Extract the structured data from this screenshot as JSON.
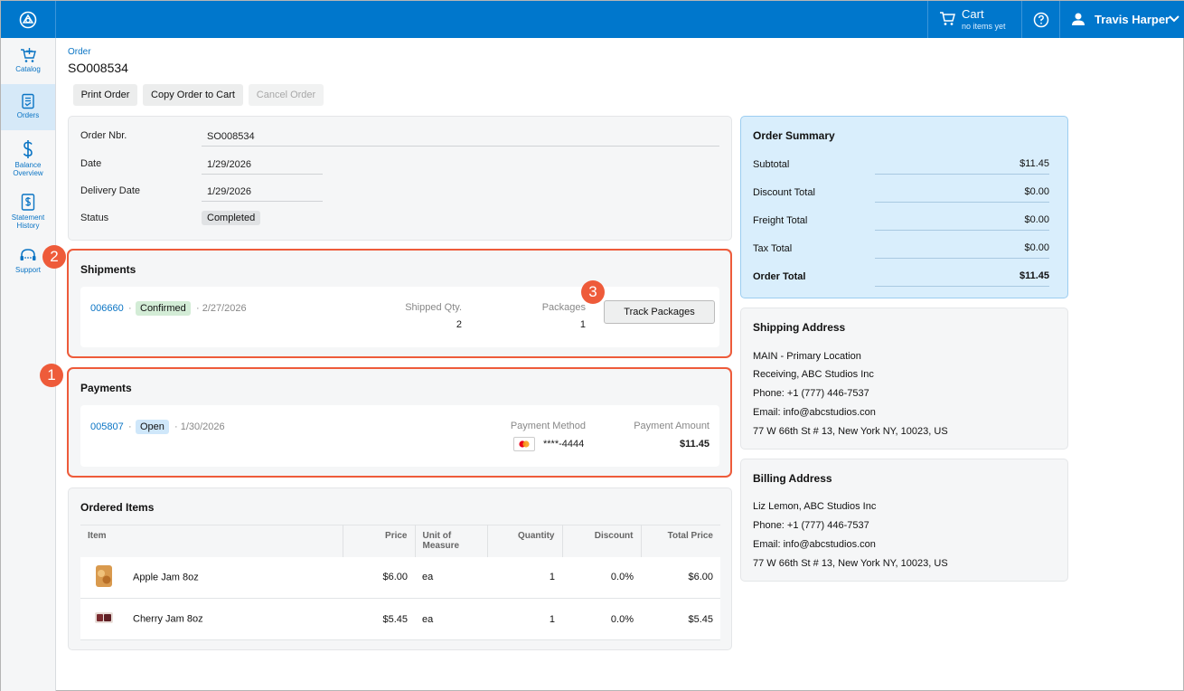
{
  "topbar": {
    "cart_label": "Cart",
    "cart_sub": "no items yet",
    "user_name": "Travis Harper"
  },
  "sidebar": {
    "items": [
      {
        "label": "Catalog",
        "icon": "cart-plus-icon"
      },
      {
        "label": "Orders",
        "icon": "orders-icon"
      },
      {
        "label": "Balance Overview",
        "icon": "dollar-icon"
      },
      {
        "label": "Statement History",
        "icon": "statement-icon"
      },
      {
        "label": "Support",
        "icon": "headset-icon"
      }
    ]
  },
  "breadcrumb": "Order",
  "page_title": "SO008534",
  "actions": {
    "print": "Print Order",
    "copy": "Copy Order to Cart",
    "cancel": "Cancel Order"
  },
  "order": {
    "nbr_label": "Order Nbr.",
    "nbr": "SO008534",
    "date_label": "Date",
    "date": "1/29/2026",
    "delivery_label": "Delivery Date",
    "delivery": "1/29/2026",
    "status_label": "Status",
    "status": "Completed"
  },
  "badges": {
    "one": "1",
    "two": "2",
    "three": "3"
  },
  "shipments": {
    "title": "Shipments",
    "number": "006660",
    "sep": "·",
    "status": "Confirmed",
    "date": "· 2/27/2026",
    "qty_label": "Shipped Qty.",
    "qty": "2",
    "packages_label": "Packages",
    "packages": "1",
    "track": "Track Packages"
  },
  "payments": {
    "title": "Payments",
    "number": "005807",
    "sep": "·",
    "status": "Open",
    "date": "· 1/30/2026",
    "method_label": "Payment Method",
    "method": "****-4444",
    "amount_label": "Payment Amount",
    "amount": "$11.45"
  },
  "items": {
    "title": "Ordered Items",
    "headers": {
      "item": "Item",
      "price": "Price",
      "uom_1": "Unit of",
      "uom_2": "Measure",
      "qty": "Quantity",
      "discount": "Discount",
      "total": "Total Price"
    },
    "rows": [
      {
        "name": "Apple Jam 8oz",
        "price": "$6.00",
        "uom": "ea",
        "qty": "1",
        "discount": "0.0%",
        "total": "$6.00"
      },
      {
        "name": "Cherry Jam 8oz",
        "price": "$5.45",
        "uom": "ea",
        "qty": "1",
        "discount": "0.0%",
        "total": "$5.45"
      }
    ]
  },
  "summary": {
    "title": "Order Summary",
    "subtotal_label": "Subtotal",
    "subtotal": "$11.45",
    "discount_label": "Discount Total",
    "discount": "$0.00",
    "freight_label": "Freight Total",
    "freight": "$0.00",
    "tax_label": "Tax Total",
    "tax": "$0.00",
    "total_label": "Order Total",
    "total": "$11.45"
  },
  "shipping": {
    "title": "Shipping Address",
    "line1": "MAIN - Primary Location",
    "line2": "Receiving, ABC Studios Inc",
    "phone": "Phone:  +1 (777) 446-7537",
    "email": "Email:  info@abcstudios.con",
    "address": "77 W 66th St # 13, New York NY, 10023, US"
  },
  "billing": {
    "title": "Billing Address",
    "line1": "Liz Lemon, ABC Studios Inc",
    "phone": "Phone:  +1 (777) 446-7537",
    "email": "Email:  info@abcstudios.con",
    "address": "77 W 66th St # 13, New York NY, 10023, US"
  },
  "colors": {
    "brand": "#0077cc",
    "highlight": "#ee5b3a",
    "summary_bg": "#d9eefc"
  }
}
